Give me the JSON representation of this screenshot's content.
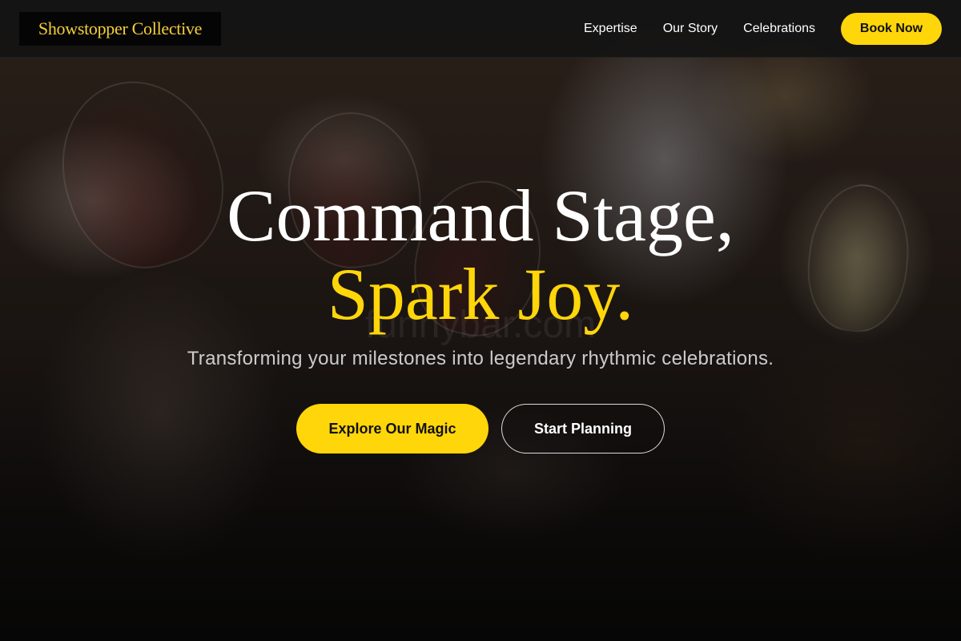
{
  "header": {
    "logo_text": "Showstopper Collective",
    "nav": [
      {
        "label": "Expertise"
      },
      {
        "label": "Our Story"
      },
      {
        "label": "Celebrations"
      }
    ],
    "book_label": "Book Now"
  },
  "hero": {
    "headline_line1": "Command Stage,",
    "headline_line2": "Spark Joy.",
    "subtitle": "Transforming your milestones into legendary rhythmic celebrations.",
    "primary_cta": "Explore Our Magic",
    "secondary_cta": "Start Planning",
    "watermark": "funnybar.com"
  },
  "colors": {
    "accent": "#ffd60a",
    "header_bg": "#141414",
    "text": "#ffffff"
  }
}
